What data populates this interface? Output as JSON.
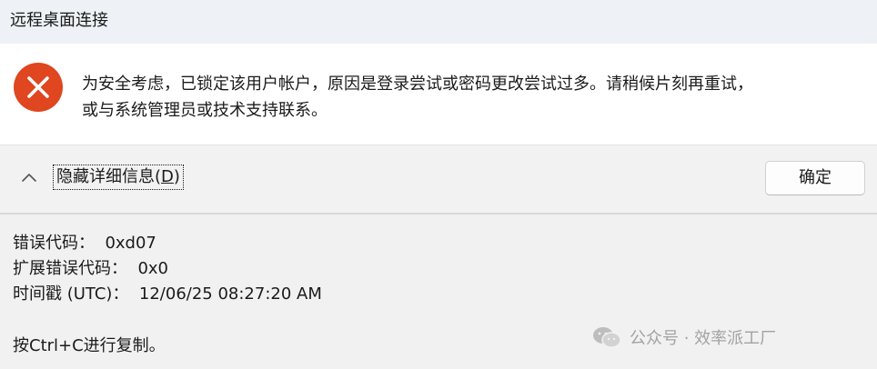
{
  "window": {
    "title": "远程桌面连接"
  },
  "message": {
    "icon": "error-icon",
    "line1": "为安全考虑，已锁定该用户帐户，原因是登录尝试或密码更改尝试过多。请稍候片刻再重试，",
    "line2": "或与系统管理员或技术支持联系。"
  },
  "toolbar": {
    "toggle_prefix": "隐藏详细信息(",
    "toggle_mnemonic": "D",
    "toggle_suffix": ")",
    "ok_label": "确定"
  },
  "details": {
    "error_code": "错误代码：  0xd07",
    "extended_error_code": "扩展错误代码：  0x0",
    "timestamp": "时间戳 (UTC)：  12/06/25 08:27:20 AM",
    "copy_hint": "按Ctrl+C进行复制。"
  },
  "watermark": {
    "text": "公众号 · 效率派工厂"
  },
  "colors": {
    "error_red": "#e0461f",
    "title_bar_bg": "#eef2f6",
    "details_bg": "#f1f1f1"
  }
}
